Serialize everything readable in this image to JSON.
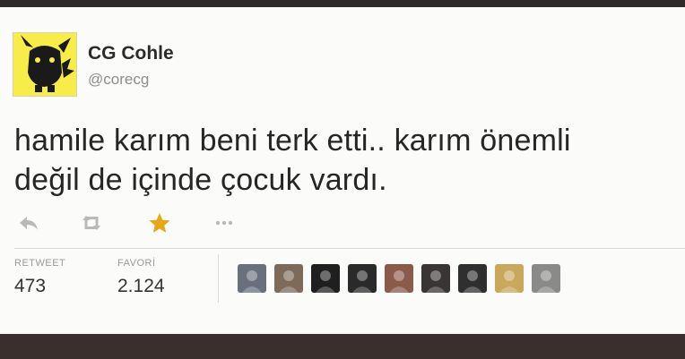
{
  "user": {
    "display_name": "CG Cohle",
    "handle": "@corecg",
    "avatar_icon": "pikachu-icon"
  },
  "tweet": {
    "lines": [
      "hamile karım beni terk etti.. karım önemli",
      "değil de içinde çocuk vardı."
    ]
  },
  "actions": [
    {
      "icon": "reply-icon"
    },
    {
      "icon": "retweet-icon"
    },
    {
      "icon": "favorite-star-icon",
      "color": "#e3a718"
    },
    {
      "icon": "more-icon"
    }
  ],
  "stats": {
    "retweet_label": "RETWEET",
    "retweet_count": "473",
    "favorite_label": "FAVORİ",
    "favorite_count": "2.124"
  },
  "favoriters": [
    {
      "icon": "user-avatar-icon",
      "color": "#6a6f7e"
    },
    {
      "icon": "user-avatar-icon",
      "color": "#7d6a5a"
    },
    {
      "icon": "user-avatar-icon",
      "color": "#1f1f1f"
    },
    {
      "icon": "user-avatar-icon",
      "color": "#2a2a2a"
    },
    {
      "icon": "user-avatar-icon",
      "color": "#8b5a4a"
    },
    {
      "icon": "user-avatar-icon",
      "color": "#3a3535"
    },
    {
      "icon": "user-avatar-icon",
      "color": "#2f2f2f"
    },
    {
      "icon": "user-avatar-icon",
      "color": "#c9a85e"
    },
    {
      "icon": "user-avatar-icon",
      "color": "#8a8a88"
    }
  ]
}
